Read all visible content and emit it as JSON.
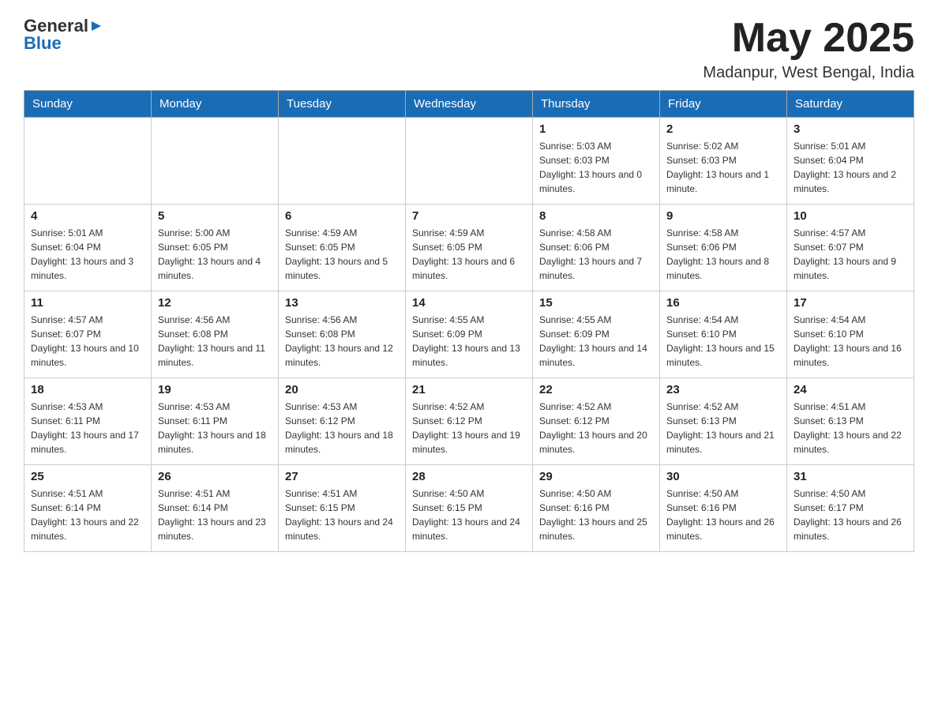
{
  "header": {
    "logo": {
      "general": "General",
      "blue": "Blue"
    },
    "month_title": "May 2025",
    "location": "Madanpur, West Bengal, India"
  },
  "days_of_week": [
    "Sunday",
    "Monday",
    "Tuesday",
    "Wednesday",
    "Thursday",
    "Friday",
    "Saturday"
  ],
  "weeks": [
    [
      {
        "day": "",
        "info": ""
      },
      {
        "day": "",
        "info": ""
      },
      {
        "day": "",
        "info": ""
      },
      {
        "day": "",
        "info": ""
      },
      {
        "day": "1",
        "info": "Sunrise: 5:03 AM\nSunset: 6:03 PM\nDaylight: 13 hours and 0 minutes."
      },
      {
        "day": "2",
        "info": "Sunrise: 5:02 AM\nSunset: 6:03 PM\nDaylight: 13 hours and 1 minute."
      },
      {
        "day": "3",
        "info": "Sunrise: 5:01 AM\nSunset: 6:04 PM\nDaylight: 13 hours and 2 minutes."
      }
    ],
    [
      {
        "day": "4",
        "info": "Sunrise: 5:01 AM\nSunset: 6:04 PM\nDaylight: 13 hours and 3 minutes."
      },
      {
        "day": "5",
        "info": "Sunrise: 5:00 AM\nSunset: 6:05 PM\nDaylight: 13 hours and 4 minutes."
      },
      {
        "day": "6",
        "info": "Sunrise: 4:59 AM\nSunset: 6:05 PM\nDaylight: 13 hours and 5 minutes."
      },
      {
        "day": "7",
        "info": "Sunrise: 4:59 AM\nSunset: 6:05 PM\nDaylight: 13 hours and 6 minutes."
      },
      {
        "day": "8",
        "info": "Sunrise: 4:58 AM\nSunset: 6:06 PM\nDaylight: 13 hours and 7 minutes."
      },
      {
        "day": "9",
        "info": "Sunrise: 4:58 AM\nSunset: 6:06 PM\nDaylight: 13 hours and 8 minutes."
      },
      {
        "day": "10",
        "info": "Sunrise: 4:57 AM\nSunset: 6:07 PM\nDaylight: 13 hours and 9 minutes."
      }
    ],
    [
      {
        "day": "11",
        "info": "Sunrise: 4:57 AM\nSunset: 6:07 PM\nDaylight: 13 hours and 10 minutes."
      },
      {
        "day": "12",
        "info": "Sunrise: 4:56 AM\nSunset: 6:08 PM\nDaylight: 13 hours and 11 minutes."
      },
      {
        "day": "13",
        "info": "Sunrise: 4:56 AM\nSunset: 6:08 PM\nDaylight: 13 hours and 12 minutes."
      },
      {
        "day": "14",
        "info": "Sunrise: 4:55 AM\nSunset: 6:09 PM\nDaylight: 13 hours and 13 minutes."
      },
      {
        "day": "15",
        "info": "Sunrise: 4:55 AM\nSunset: 6:09 PM\nDaylight: 13 hours and 14 minutes."
      },
      {
        "day": "16",
        "info": "Sunrise: 4:54 AM\nSunset: 6:10 PM\nDaylight: 13 hours and 15 minutes."
      },
      {
        "day": "17",
        "info": "Sunrise: 4:54 AM\nSunset: 6:10 PM\nDaylight: 13 hours and 16 minutes."
      }
    ],
    [
      {
        "day": "18",
        "info": "Sunrise: 4:53 AM\nSunset: 6:11 PM\nDaylight: 13 hours and 17 minutes."
      },
      {
        "day": "19",
        "info": "Sunrise: 4:53 AM\nSunset: 6:11 PM\nDaylight: 13 hours and 18 minutes."
      },
      {
        "day": "20",
        "info": "Sunrise: 4:53 AM\nSunset: 6:12 PM\nDaylight: 13 hours and 18 minutes."
      },
      {
        "day": "21",
        "info": "Sunrise: 4:52 AM\nSunset: 6:12 PM\nDaylight: 13 hours and 19 minutes."
      },
      {
        "day": "22",
        "info": "Sunrise: 4:52 AM\nSunset: 6:12 PM\nDaylight: 13 hours and 20 minutes."
      },
      {
        "day": "23",
        "info": "Sunrise: 4:52 AM\nSunset: 6:13 PM\nDaylight: 13 hours and 21 minutes."
      },
      {
        "day": "24",
        "info": "Sunrise: 4:51 AM\nSunset: 6:13 PM\nDaylight: 13 hours and 22 minutes."
      }
    ],
    [
      {
        "day": "25",
        "info": "Sunrise: 4:51 AM\nSunset: 6:14 PM\nDaylight: 13 hours and 22 minutes."
      },
      {
        "day": "26",
        "info": "Sunrise: 4:51 AM\nSunset: 6:14 PM\nDaylight: 13 hours and 23 minutes."
      },
      {
        "day": "27",
        "info": "Sunrise: 4:51 AM\nSunset: 6:15 PM\nDaylight: 13 hours and 24 minutes."
      },
      {
        "day": "28",
        "info": "Sunrise: 4:50 AM\nSunset: 6:15 PM\nDaylight: 13 hours and 24 minutes."
      },
      {
        "day": "29",
        "info": "Sunrise: 4:50 AM\nSunset: 6:16 PM\nDaylight: 13 hours and 25 minutes."
      },
      {
        "day": "30",
        "info": "Sunrise: 4:50 AM\nSunset: 6:16 PM\nDaylight: 13 hours and 26 minutes."
      },
      {
        "day": "31",
        "info": "Sunrise: 4:50 AM\nSunset: 6:17 PM\nDaylight: 13 hours and 26 minutes."
      }
    ]
  ]
}
